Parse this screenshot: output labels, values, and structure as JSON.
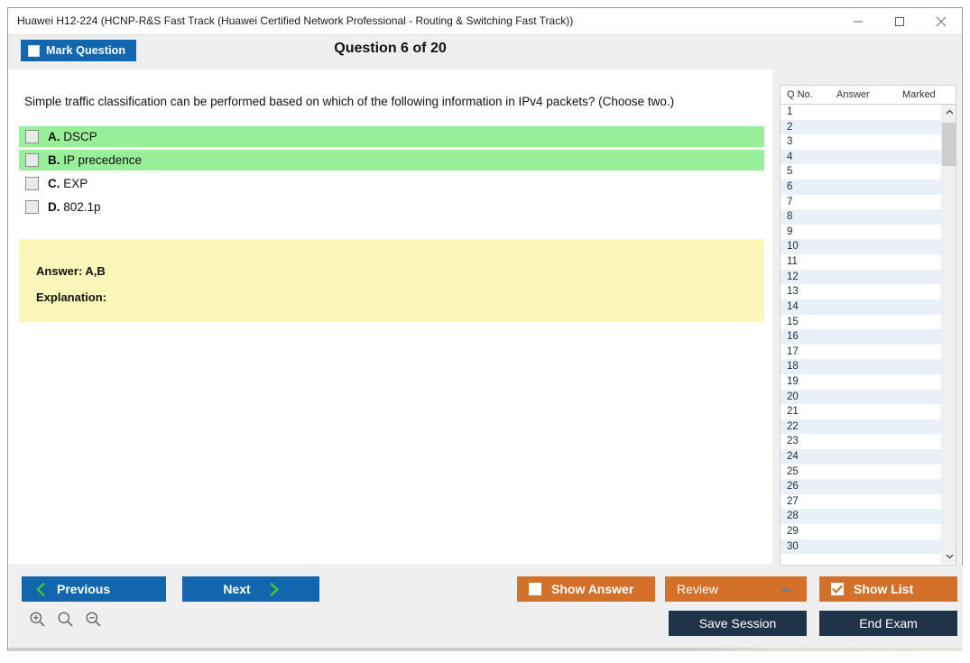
{
  "window": {
    "title": "Huawei H12-224 (HCNP-R&S Fast Track (Huawei Certified Network Professional - Routing & Switching Fast Track))",
    "controls": {
      "minimize": "minimize-icon",
      "maximize": "maximize-icon",
      "close": "close-icon"
    }
  },
  "toolbar": {
    "mark_question_label": "Mark Question",
    "mark_question_checked": false,
    "question_title": "Question 6 of 20"
  },
  "question": {
    "text": "Simple traffic classification can be performed based on which of the following information in IPv4 packets? (Choose two.)",
    "options": [
      {
        "letter": "A.",
        "text": "DSCP",
        "correct": true,
        "checked": false
      },
      {
        "letter": "B.",
        "text": "IP precedence",
        "correct": true,
        "checked": false
      },
      {
        "letter": "C.",
        "text": "EXP",
        "correct": false,
        "checked": false
      },
      {
        "letter": "D.",
        "text": "802.1p",
        "correct": false,
        "checked": false
      }
    ]
  },
  "answer_panel": {
    "answer_label": "Answer: A,B",
    "explanation_label": "Explanation:"
  },
  "question_list": {
    "headers": [
      "Q No.",
      "Answer",
      "Marked"
    ],
    "rows": [
      {
        "no": "1",
        "answer": "",
        "marked": ""
      },
      {
        "no": "2",
        "answer": "",
        "marked": ""
      },
      {
        "no": "3",
        "answer": "",
        "marked": ""
      },
      {
        "no": "4",
        "answer": "",
        "marked": ""
      },
      {
        "no": "5",
        "answer": "",
        "marked": ""
      },
      {
        "no": "6",
        "answer": "",
        "marked": ""
      },
      {
        "no": "7",
        "answer": "",
        "marked": ""
      },
      {
        "no": "8",
        "answer": "",
        "marked": ""
      },
      {
        "no": "9",
        "answer": "",
        "marked": ""
      },
      {
        "no": "10",
        "answer": "",
        "marked": ""
      },
      {
        "no": "11",
        "answer": "",
        "marked": ""
      },
      {
        "no": "12",
        "answer": "",
        "marked": ""
      },
      {
        "no": "13",
        "answer": "",
        "marked": ""
      },
      {
        "no": "14",
        "answer": "",
        "marked": ""
      },
      {
        "no": "15",
        "answer": "",
        "marked": ""
      },
      {
        "no": "16",
        "answer": "",
        "marked": ""
      },
      {
        "no": "17",
        "answer": "",
        "marked": ""
      },
      {
        "no": "18",
        "answer": "",
        "marked": ""
      },
      {
        "no": "19",
        "answer": "",
        "marked": ""
      },
      {
        "no": "20",
        "answer": "",
        "marked": ""
      },
      {
        "no": "21",
        "answer": "",
        "marked": ""
      },
      {
        "no": "22",
        "answer": "",
        "marked": ""
      },
      {
        "no": "23",
        "answer": "",
        "marked": ""
      },
      {
        "no": "24",
        "answer": "",
        "marked": ""
      },
      {
        "no": "25",
        "answer": "",
        "marked": ""
      },
      {
        "no": "26",
        "answer": "",
        "marked": ""
      },
      {
        "no": "27",
        "answer": "",
        "marked": ""
      },
      {
        "no": "28",
        "answer": "",
        "marked": ""
      },
      {
        "no": "29",
        "answer": "",
        "marked": ""
      },
      {
        "no": "30",
        "answer": "",
        "marked": ""
      }
    ]
  },
  "footer": {
    "previous_label": "Previous",
    "next_label": "Next",
    "show_answer_label": "Show Answer",
    "show_answer_checked": false,
    "review_label": "Review",
    "show_list_label": "Show List",
    "show_list_checked": true,
    "save_session_label": "Save Session",
    "end_exam_label": "End Exam",
    "zoom_icons": [
      "zoom-in-icon",
      "zoom-reset-icon",
      "zoom-out-icon"
    ]
  },
  "colors": {
    "accent_blue": "#1266ae",
    "accent_orange": "#d3702a",
    "navy": "#1f3349",
    "correct_green": "#99ee99",
    "answer_yellow": "#fbf7b8"
  }
}
